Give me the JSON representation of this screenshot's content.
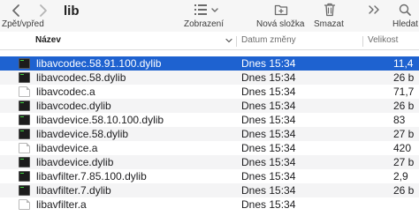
{
  "toolbar": {
    "nav_label": "Zpět/vpřed",
    "folder_title": "lib",
    "view_label": "Zobrazení",
    "new_folder_label": "Nová složka",
    "delete_label": "Smazat",
    "search_label": "Hledat"
  },
  "columns": {
    "name": "Název",
    "date": "Datum změny",
    "size": "Velikost"
  },
  "files": [
    {
      "name": "libavcodec.58.91.100.dylib",
      "date": "Dnes 15:34",
      "size": "11,4",
      "icon": "executable-file-icon",
      "selected": true
    },
    {
      "name": "libavcodec.58.dylib",
      "date": "Dnes 15:34",
      "size": "26 b",
      "icon": "executable-file-icon",
      "selected": false
    },
    {
      "name": "libavcodec.a",
      "date": "Dnes 15:34",
      "size": "71,7",
      "icon": "document-file-icon",
      "selected": false
    },
    {
      "name": "libavcodec.dylib",
      "date": "Dnes 15:34",
      "size": "26 b",
      "icon": "executable-file-icon",
      "selected": false
    },
    {
      "name": "libavdevice.58.10.100.dylib",
      "date": "Dnes 15:34",
      "size": "83",
      "icon": "executable-file-icon",
      "selected": false
    },
    {
      "name": "libavdevice.58.dylib",
      "date": "Dnes 15:34",
      "size": "27 b",
      "icon": "executable-file-icon",
      "selected": false
    },
    {
      "name": "libavdevice.a",
      "date": "Dnes 15:34",
      "size": "420",
      "icon": "document-file-icon",
      "selected": false
    },
    {
      "name": "libavdevice.dylib",
      "date": "Dnes 15:34",
      "size": "27 b",
      "icon": "executable-file-icon",
      "selected": false
    },
    {
      "name": "libavfilter.7.85.100.dylib",
      "date": "Dnes 15:34",
      "size": "2,9",
      "icon": "executable-file-icon",
      "selected": false
    },
    {
      "name": "libavfilter.7.dylib",
      "date": "Dnes 15:34",
      "size": "26 b",
      "icon": "executable-file-icon",
      "selected": false
    },
    {
      "name": "libavfilter.a",
      "date": "Dnes 15:34",
      "size": "",
      "icon": "document-file-icon",
      "selected": false
    }
  ],
  "colors": {
    "selection": "#1e62d0",
    "alt_row": "#f4f4f5",
    "toolbar_bg": "#f6f6f6"
  }
}
